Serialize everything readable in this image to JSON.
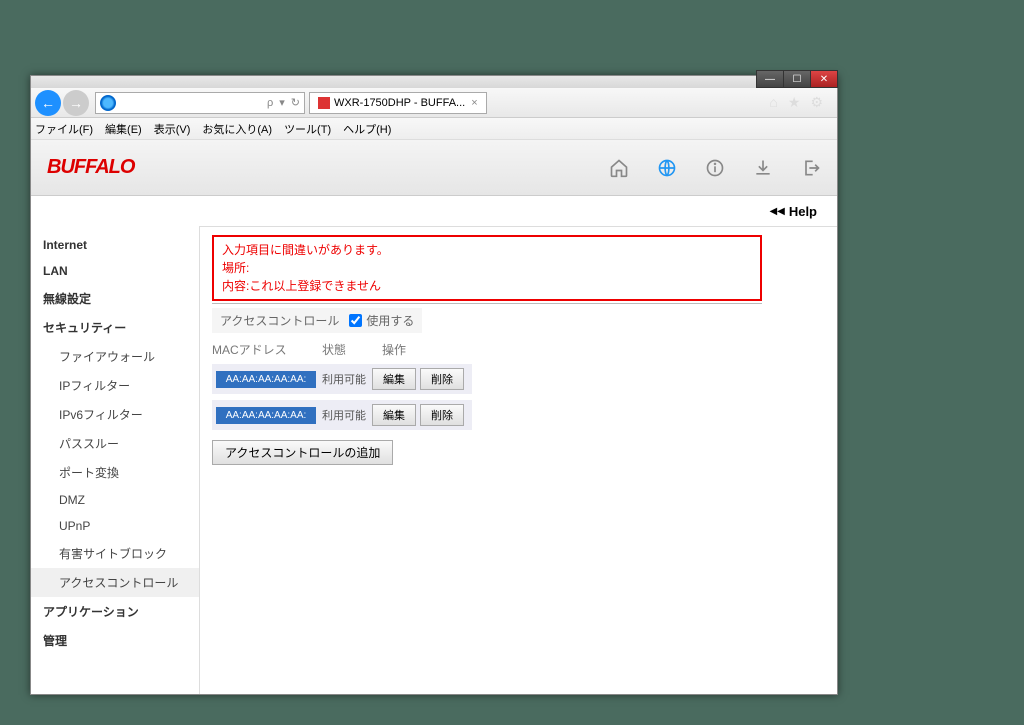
{
  "window": {
    "tab_title": "WXR-1750DHP - BUFFA...",
    "search_hint": "🔍",
    "refresh": "↻"
  },
  "menu": {
    "file": "ファイル(F)",
    "edit": "編集(E)",
    "view": "表示(V)",
    "favorites": "お気に入り(A)",
    "tools": "ツール(T)",
    "help_m": "ヘルプ(H)"
  },
  "brand": "BUFFALO",
  "help": "Help",
  "sidebar": {
    "internet": "Internet",
    "lan": "LAN",
    "wireless": "無線設定",
    "security": "セキュリティー",
    "firewall": "ファイアウォール",
    "ipfilter": "IPフィルター",
    "ipv6filter": "IPv6フィルター",
    "passthrough": "パススルー",
    "portfwd": "ポート変換",
    "dmz": "DMZ",
    "upnp": "UPnP",
    "siteblock": "有害サイトブロック",
    "accesscontrol": "アクセスコントロール",
    "application": "アプリケーション",
    "admin": "管理"
  },
  "error": {
    "line1": "入力項目に間違いがあります。",
    "line2": "場所:",
    "line3": "内容:これ以上登録できません"
  },
  "panel": {
    "access_label": "アクセスコントロール",
    "use_label": "使用する",
    "col_mac": "MACアドレス",
    "col_status": "状態",
    "col_action": "操作",
    "rows": [
      {
        "mac": "AA:AA:AA:AA:AA:",
        "status": "利用可能",
        "edit": "編集",
        "del": "削除"
      },
      {
        "mac": "AA:AA:AA:AA:AA:",
        "status": "利用可能",
        "edit": "編集",
        "del": "削除"
      }
    ],
    "add_button": "アクセスコントロールの追加"
  }
}
